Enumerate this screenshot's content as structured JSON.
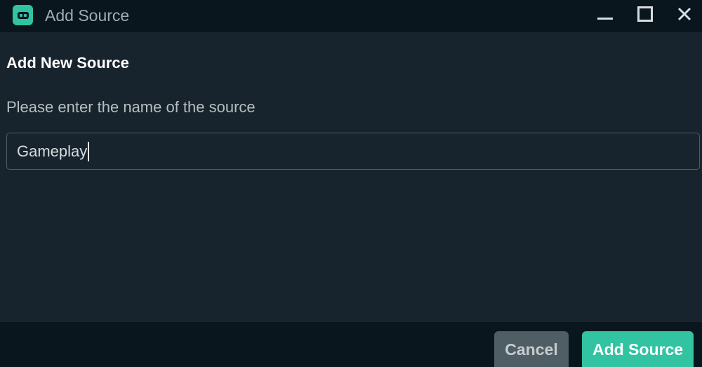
{
  "window": {
    "title": "Add Source"
  },
  "dialog": {
    "heading": "Add New Source",
    "prompt": "Please enter the name of the source",
    "name_input": {
      "value": "Gameplay"
    }
  },
  "footer": {
    "cancel_label": "Cancel",
    "submit_label": "Add Source"
  },
  "icons": {
    "app": "streamlabs-robot-icon",
    "minimize": "minimize-icon",
    "maximize": "maximize-icon",
    "close": "close-icon"
  },
  "colors": {
    "accent": "#31c3a2",
    "titlebar_bg": "#09161d",
    "body_bg": "#17242d",
    "cancel_bg": "#4f5e65"
  }
}
